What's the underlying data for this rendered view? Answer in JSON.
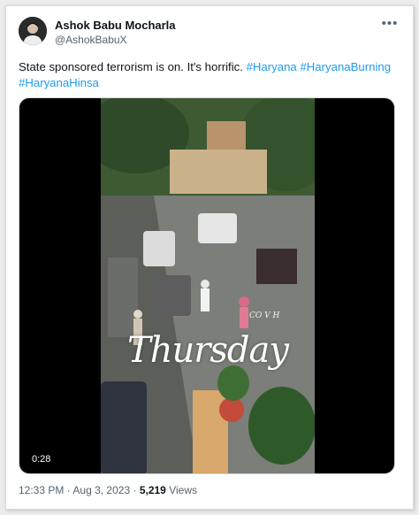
{
  "author": {
    "name": "Ashok Babu Mocharla",
    "handle": "@AshokBabuX"
  },
  "tweet": {
    "text": "State sponsored terrorism is on. It's horrific.",
    "hashtags": [
      "#Haryana",
      "#HaryanaBurning",
      "#HaryanaHinsa"
    ]
  },
  "media": {
    "overlay_word": "Thursday",
    "watermark": "CO V H",
    "duration": "0:28"
  },
  "meta": {
    "time": "12:33 PM",
    "separator": "·",
    "date": "Aug 3, 2023",
    "views_count": "5,219",
    "views_label": "Views"
  },
  "icons": {
    "more": "more-options-icon"
  },
  "colors": {
    "link": "#1d9bf0",
    "secondary_text": "#536471"
  }
}
